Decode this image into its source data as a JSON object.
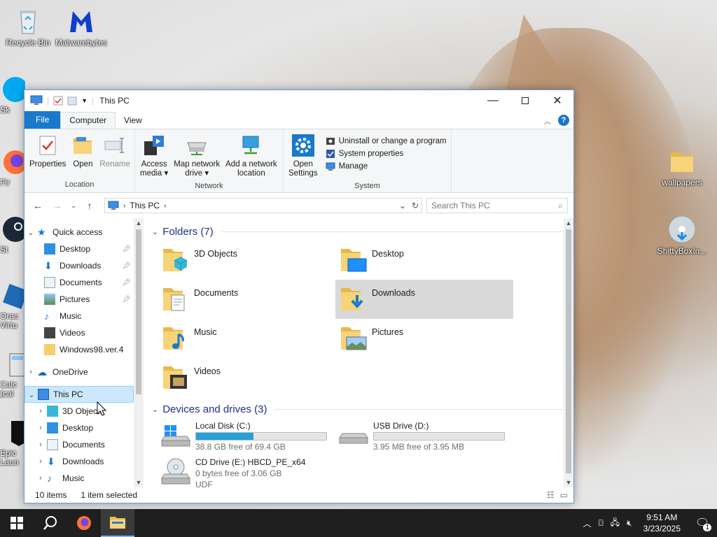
{
  "desktop": {
    "icons": [
      {
        "label": "Recycle Bin"
      },
      {
        "label": "Malwarebytes"
      },
      {
        "label": "wallpapers"
      },
      {
        "label": "ShittyBoxIn..."
      },
      {
        "label": "Sk"
      },
      {
        "label": "Fir"
      },
      {
        "label": "St"
      },
      {
        "label": "Orac Virtu"
      },
      {
        "label": "Calc (cal"
      },
      {
        "label": "Epic Laun"
      }
    ]
  },
  "window": {
    "title": "This PC",
    "tabs": {
      "file": "File",
      "computer": "Computer",
      "view": "View"
    },
    "ribbon": {
      "location": {
        "name": "Location",
        "properties": "Properties",
        "open": "Open",
        "rename": "Rename"
      },
      "network": {
        "name": "Network",
        "access_media_1": "Access",
        "access_media_2": "media ▾",
        "map_drive_1": "Map network",
        "map_drive_2": "drive ▾",
        "add_location_1": "Add a network",
        "add_location_2": "location"
      },
      "system": {
        "name": "System",
        "open_settings_1": "Open",
        "open_settings_2": "Settings",
        "uninstall": "Uninstall or change a program",
        "system_properties": "System properties",
        "manage": "Manage"
      }
    },
    "address": {
      "path": "This PC",
      "search_placeholder": "Search This PC"
    },
    "nav_pane": {
      "quick_access": "Quick access",
      "quick_items": [
        "Desktop",
        "Downloads",
        "Documents",
        "Pictures",
        "Music",
        "Videos",
        "Windows98.ver.4"
      ],
      "onedrive": "OneDrive",
      "this_pc": "This PC",
      "pc_items": [
        "3D Objects",
        "Desktop",
        "Documents",
        "Downloads",
        "Music"
      ]
    },
    "folders_header": "Folders (7)",
    "folders": [
      "3D Objects",
      "Desktop",
      "Documents",
      "Downloads",
      "Music",
      "Pictures",
      "Videos"
    ],
    "devices_header": "Devices and drives (3)",
    "drives": {
      "c": {
        "name": "Local Disk (C:)",
        "free": "38.8 GB free of 69.4 GB",
        "used_fraction": 0.44
      },
      "d": {
        "name": "USB Drive (D:)",
        "free": "3.95 MB free of 3.95 MB",
        "used_fraction": 0.0
      },
      "e": {
        "name": "CD Drive (E:) HBCD_PE_x64",
        "free": "0 bytes free of 3.06 GB",
        "fs": "UDF"
      }
    },
    "status": {
      "items": "10 items",
      "selected": "1 item selected"
    }
  },
  "taskbar": {
    "time": "9:51 AM",
    "date": "3/23/2025",
    "notifications": "1"
  },
  "colors": {
    "accent": "#1979ca",
    "selection": "#cce8ff",
    "bar_fill": "#26a0da",
    "taskbar": "#1f1f1f"
  }
}
